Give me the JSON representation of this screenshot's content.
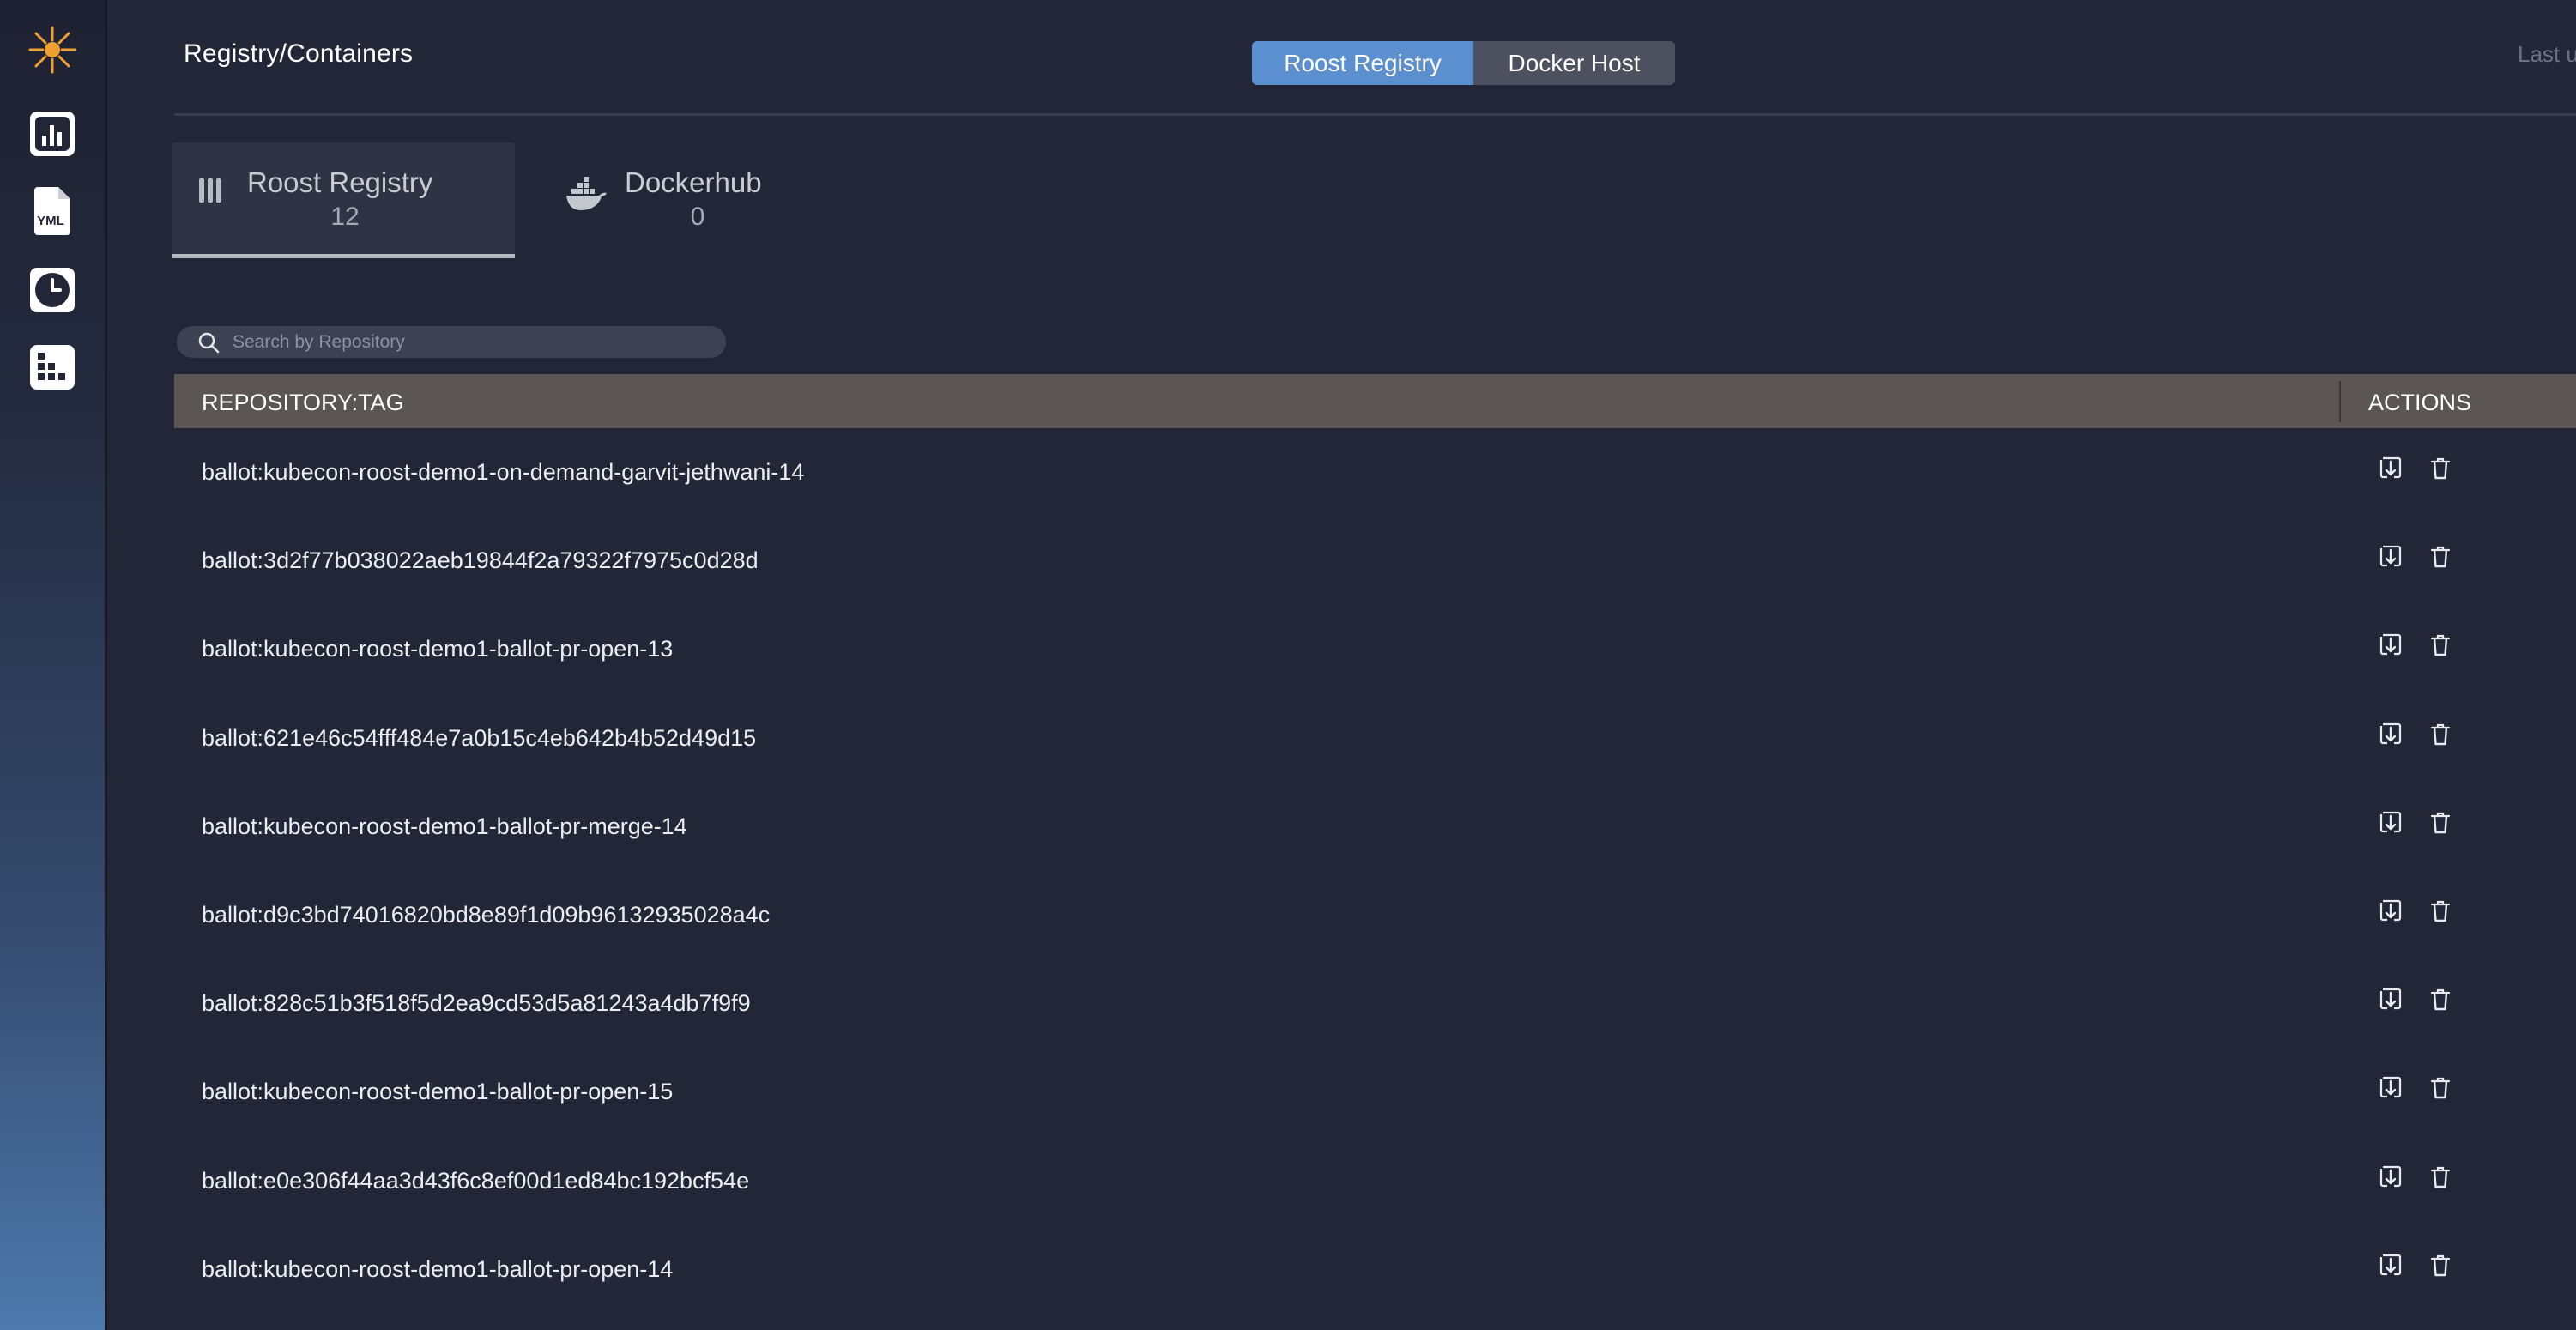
{
  "app": {
    "page_title": "Registry/Containers",
    "last_updated_label": "Last u"
  },
  "sidebar": {
    "items": [
      {
        "name": "logo-icon"
      },
      {
        "name": "stats-icon"
      },
      {
        "name": "yml-file-icon",
        "label": "YML"
      },
      {
        "name": "clock-icon"
      },
      {
        "name": "registry-grid-icon"
      }
    ]
  },
  "segmented": {
    "options": [
      {
        "label": "Roost Registry",
        "active": true
      },
      {
        "label": "Docker Host",
        "active": false
      }
    ]
  },
  "registries": [
    {
      "name": "Roost Registry",
      "count": "12",
      "icon": "roost-registry-icon",
      "selected": true
    },
    {
      "name": "Dockerhub",
      "count": "0",
      "icon": "docker-whale-icon",
      "selected": false
    }
  ],
  "search": {
    "placeholder": "Search by Repository",
    "value": ""
  },
  "table": {
    "columns": [
      "REPOSITORY:TAG",
      "ACTIONS"
    ],
    "rows": [
      "ballot:kubecon-roost-demo1-on-demand-garvit-jethwani-14",
      "ballot:3d2f77b038022aeb19844f2a79322f7975c0d28d",
      "ballot:kubecon-roost-demo1-ballot-pr-open-13",
      "ballot:621e46c54fff484e7a0b15c4eb642b4b52d49d15",
      "ballot:kubecon-roost-demo1-ballot-pr-merge-14",
      "ballot:d9c3bd74016820bd8e89f1d09b96132935028a4c",
      "ballot:828c51b3f518f5d2ea9cd53d5a81243a4db7f9f9",
      "ballot:kubecon-roost-demo1-ballot-pr-open-15",
      "ballot:e0e306f44aa3d43f6c8ef00d1ed84bc192bcf54e",
      "ballot:kubecon-roost-demo1-ballot-pr-open-14"
    ],
    "row_actions": [
      "pull-icon",
      "trash-icon"
    ]
  },
  "colors": {
    "background": "#232637",
    "segment_active": "#5b8fd0",
    "table_header": "#5b5553",
    "logo_accent": "#f0a030"
  }
}
